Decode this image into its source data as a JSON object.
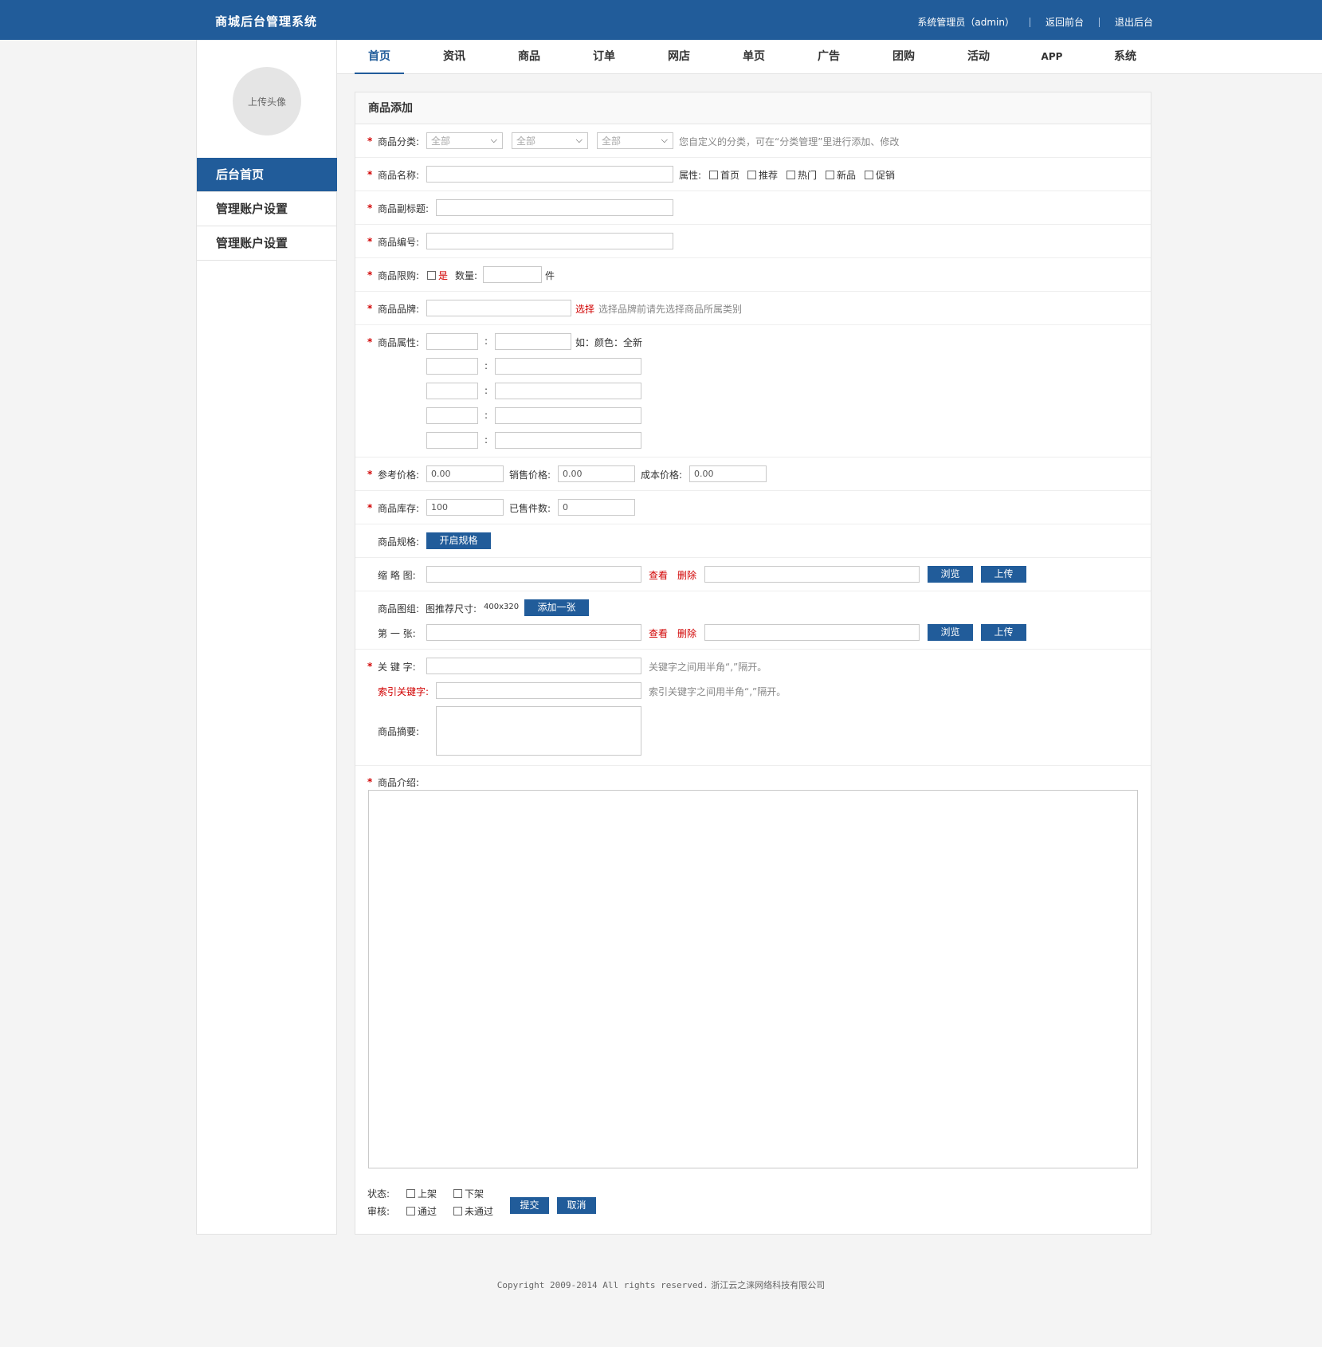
{
  "header": {
    "title": "商城后台管理系统",
    "user": "系统管理员（admin）",
    "back_front": "返回前台",
    "logout": "退出后台",
    "brand_color": "#215c9a"
  },
  "sidebar": {
    "avatar_label": "上传头像",
    "items": [
      {
        "label": "后台首页",
        "active": true
      },
      {
        "label": "管理账户设置",
        "active": false
      },
      {
        "label": "管理账户设置",
        "active": false
      }
    ]
  },
  "nav": {
    "tabs": [
      "首页",
      "资讯",
      "商品",
      "订单",
      "网店",
      "单页",
      "广告",
      "团购",
      "活动",
      "APP",
      "系统"
    ],
    "active": "首页"
  },
  "form": {
    "title": "商品添加",
    "category": {
      "label": "商品分类:",
      "selects": [
        "全部",
        "全部",
        "全部"
      ],
      "hint": "您自定义的分类，可在“分类管理”里进行添加、修改"
    },
    "name": {
      "label": "商品名称:",
      "attr_label": "属性:",
      "attrs": [
        "首页",
        "推荐",
        "热门",
        "新品",
        "促销"
      ]
    },
    "subtitle": {
      "label": "商品副标题:"
    },
    "code": {
      "label": "商品编号:"
    },
    "limit": {
      "label": "商品限购:",
      "yes": "是",
      "qty_label": "数量:",
      "unit": "件"
    },
    "brand": {
      "label": "商品品牌:",
      "select": "选择",
      "hint": "选择品牌前请先选择商品所属类别"
    },
    "props": {
      "label": "商品属性:",
      "colon": ":",
      "example": "如：颜色：全新"
    },
    "price": {
      "ref_label": "参考价格:",
      "ref_value": "0.00",
      "sale_label": "销售价格:",
      "sale_value": "0.00",
      "cost_label": "成本价格:",
      "cost_value": "0.00"
    },
    "stock": {
      "label": "商品库存:",
      "value": "100",
      "sold_label": "已售件数:",
      "sold_value": "0"
    },
    "spec": {
      "label": "商品规格:",
      "button": "开启规格"
    },
    "thumb": {
      "label": "缩 略 图:",
      "view": "查看",
      "delete": "删除",
      "browse": "浏览",
      "upload": "上传"
    },
    "gallery": {
      "label": "商品图组:",
      "size_hint_prefix": "图推荐尺寸:",
      "size_hint_value": "400x320",
      "add": "添加一张",
      "first_label": "第 一 张:",
      "view": "查看",
      "delete": "删除",
      "browse": "浏览",
      "upload": "上传"
    },
    "keywords": {
      "label": "关 键 字:",
      "hint": "关键字之间用半角“,”隔开。"
    },
    "index_keywords": {
      "label": "索引关键字:",
      "hint": "索引关键字之间用半角“,”隔开。"
    },
    "summary": {
      "label": "商品摘要:"
    },
    "intro": {
      "label": "商品介绍:"
    },
    "status": {
      "label": "状态:",
      "options": [
        "上架",
        "下架"
      ]
    },
    "audit": {
      "label": "审核:",
      "options": [
        "通过",
        "未通过"
      ]
    },
    "submit": "提交",
    "cancel": "取消"
  },
  "footer": {
    "copyright": "Copyright 2009-2014 All rights reserved.",
    "company": "浙江云之涞网络科技有限公司"
  }
}
